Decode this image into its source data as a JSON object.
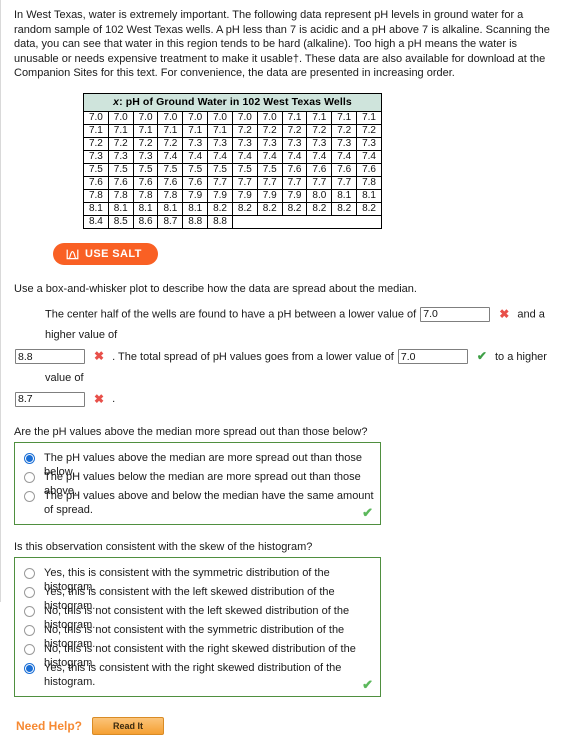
{
  "intro": {
    "paragraph": "In West Texas, water is extremely important. The following data represent pH levels in ground water for a random sample of 102 West Texas wells. A pH less than 7 is acidic and a pH above 7 is alkaline. Scanning the data, you can see that water in this region tends to be hard (alkaline). Too high a pH means the water is unusable or needs expensive treatment to make it usable†. These data are also available for download at the Companion Sites for this text. For convenience, the data are presented in increasing order."
  },
  "table": {
    "caption_prefix": "x",
    "caption": ": pH of Ground Water in 102 West Texas Wells",
    "columns": 12,
    "rows": [
      [
        "7.0",
        "7.0",
        "7.0",
        "7.0",
        "7.0",
        "7.0",
        "7.0",
        "7.0",
        "7.1",
        "7.1",
        "7.1",
        "7.1"
      ],
      [
        "7.1",
        "7.1",
        "7.1",
        "7.1",
        "7.1",
        "7.1",
        "7.2",
        "7.2",
        "7.2",
        "7.2",
        "7.2",
        "7.2"
      ],
      [
        "7.2",
        "7.2",
        "7.2",
        "7.2",
        "7.3",
        "7.3",
        "7.3",
        "7.3",
        "7.3",
        "7.3",
        "7.3",
        "7.3"
      ],
      [
        "7.3",
        "7.3",
        "7.3",
        "7.4",
        "7.4",
        "7.4",
        "7.4",
        "7.4",
        "7.4",
        "7.4",
        "7.4",
        "7.4"
      ],
      [
        "7.5",
        "7.5",
        "7.5",
        "7.5",
        "7.5",
        "7.5",
        "7.5",
        "7.5",
        "7.6",
        "7.6",
        "7.6",
        "7.6"
      ],
      [
        "7.6",
        "7.6",
        "7.6",
        "7.6",
        "7.6",
        "7.7",
        "7.7",
        "7.7",
        "7.7",
        "7.7",
        "7.7",
        "7.8"
      ],
      [
        "7.8",
        "7.8",
        "7.8",
        "7.8",
        "7.9",
        "7.9",
        "7.9",
        "7.9",
        "7.9",
        "8.0",
        "8.1",
        "8.1"
      ],
      [
        "8.1",
        "8.1",
        "8.1",
        "8.1",
        "8.1",
        "8.2",
        "8.2",
        "8.2",
        "8.2",
        "8.2",
        "8.2",
        "8.2"
      ],
      [
        "8.4",
        "8.5",
        "8.6",
        "8.7",
        "8.8",
        "8.8",
        "",
        "",
        "",
        "",
        "",
        ""
      ]
    ]
  },
  "salt": {
    "label": "USE SALT",
    "icon": "distribution-curve-icon",
    "color": "#f96024"
  },
  "fill_in": {
    "prompt": "Use a box-and-whisker plot to describe how the data are spread about the median.",
    "text_1": "The center half of the wells are found to have a pH between a lower value of",
    "input_1": {
      "value": "7.0",
      "status": "wrong"
    },
    "text_2": "and a higher value of",
    "input_2": {
      "value": "8.8",
      "status": "wrong"
    },
    "text_3": ". The total spread of pH values goes from a lower value of",
    "input_3": {
      "value": "7.0",
      "status": "right"
    },
    "text_4": "to a higher value of",
    "input_4": {
      "value": "8.7",
      "status": "wrong"
    },
    "text_5": ".",
    "mark_wrong": "✖",
    "mark_right": "✔"
  },
  "question_1": {
    "text": "Are the pH values above the median more spread out than those below?",
    "options": [
      {
        "label": "The pH values above the median are more spread out than those below.",
        "selected": true
      },
      {
        "label": "The pH values below the median are more spread out than those above.",
        "selected": false
      },
      {
        "label": "The pH values above and below the median have the same amount of spread.",
        "selected": false
      }
    ],
    "result_mark": "✔"
  },
  "question_2": {
    "text": "Is this observation consistent with the skew of the histogram?",
    "options": [
      {
        "label": "Yes, this is consistent with the symmetric distribution of the histogram.",
        "selected": false
      },
      {
        "label": "Yes, this is consistent with the left skewed distribution of the histogram.",
        "selected": false
      },
      {
        "label": "No, this is not consistent with the left skewed distribution of the histogram.",
        "selected": false
      },
      {
        "label": "No, this is not consistent with the symmetric distribution of the histogram.",
        "selected": false
      },
      {
        "label": "No, this is not consistent with the right skewed distribution of the histogram.",
        "selected": false
      },
      {
        "label": "Yes, this is consistent with the right skewed distribution of the histogram.",
        "selected": true
      }
    ],
    "result_mark": "✔"
  },
  "footer": {
    "need_help_label": "Need Help?",
    "read_it_label": "Read It"
  }
}
